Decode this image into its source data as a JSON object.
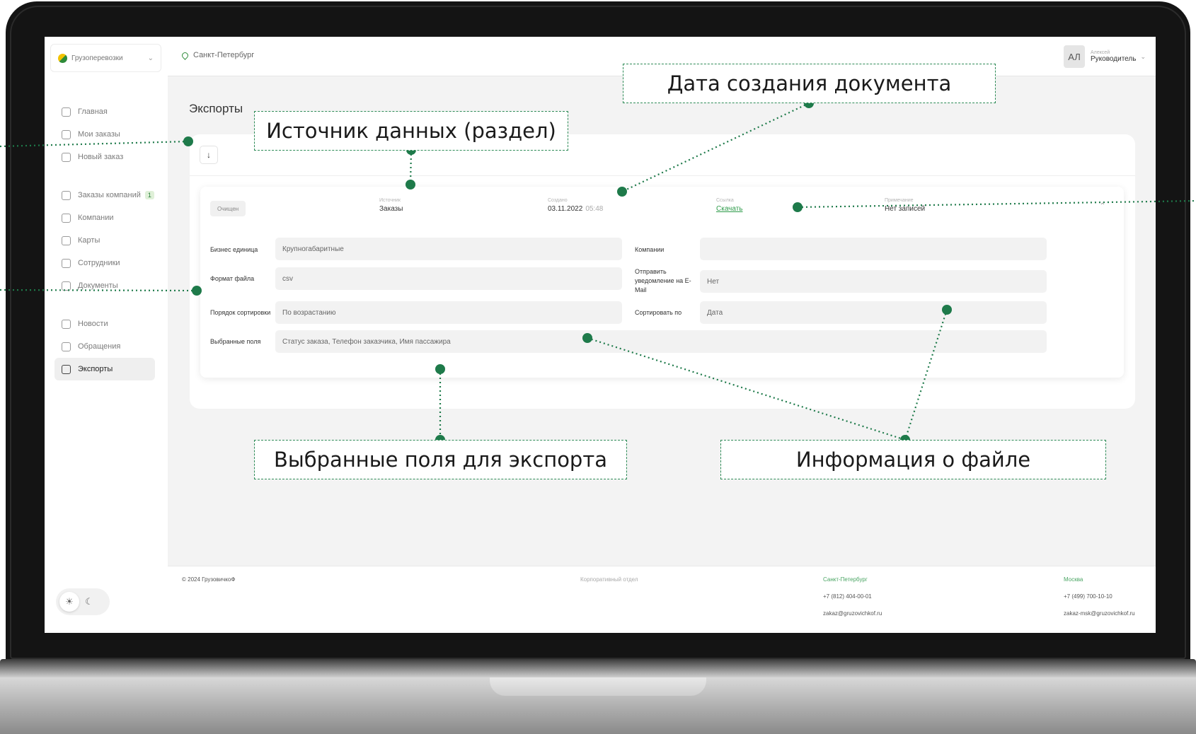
{
  "sidebar": {
    "company": "Грузоперевозки",
    "nav": [
      {
        "label": "Главная",
        "icon": "home-icon"
      },
      {
        "label": "Мои заказы",
        "icon": "orders-icon"
      },
      {
        "label": "Новый заказ",
        "icon": "new-order-icon"
      },
      {
        "label": "Заказы компаний",
        "icon": "company-orders-icon",
        "badge": "1"
      },
      {
        "label": "Компании",
        "icon": "companies-icon"
      },
      {
        "label": "Карты",
        "icon": "cards-icon"
      },
      {
        "label": "Сотрудники",
        "icon": "employees-icon"
      },
      {
        "label": "Документы",
        "icon": "documents-icon"
      },
      {
        "label": "Новости",
        "icon": "news-icon"
      },
      {
        "label": "Обращения",
        "icon": "bell-icon"
      },
      {
        "label": "Экспорты",
        "icon": "export-icon",
        "active": true
      }
    ]
  },
  "topbar": {
    "city": "Санкт-Петербург",
    "avatar": "АЛ",
    "user_name": "Алексей",
    "user_role": "Руководитель"
  },
  "page": {
    "title": "Экспорты"
  },
  "export_card": {
    "status": "Очищен",
    "source_label": "Источник",
    "source_value": "Заказы",
    "created_label": "Создано",
    "created_date": "03.11.2022",
    "created_time": "05:48",
    "link_label": "Ссылка",
    "link_value": "Скачать",
    "extra_label": "Примечание",
    "extra_value": "Нет записей",
    "fields": {
      "business_unit_label": "Бизнес единица",
      "business_unit_value": "Крупногабаритные",
      "companies_label": "Компании",
      "companies_value": "",
      "file_format_label": "Формат файла",
      "file_format_value": "csv",
      "notify_label": "Отправить уведомление на E-Mail",
      "notify_value": "Нет",
      "sort_order_label": "Порядок сортировки",
      "sort_order_value": "По возрастанию",
      "sort_by_label": "Сортировать по",
      "sort_by_value": "Дата",
      "selected_fields_label": "Выбранные поля",
      "selected_fields_value": "Статус заказа, Телефон заказчика, Имя пассажира"
    }
  },
  "footer": {
    "copyright": "© 2024 ГрузовичкоФ",
    "dept": "Корпоративный отдел",
    "spb_city": "Санкт-Петербург",
    "spb_phone": "+7 (812) 404-00-01",
    "spb_email": "zakaz@gruzovichkof.ru",
    "msk_city": "Москва",
    "msk_phone": "+7 (499) 700-10-10",
    "msk_email": "zakaz-msk@gruzovichkof.ru"
  },
  "annotations": {
    "data_source": "Источник данных (раздел)",
    "created_date": "Дата создания документа",
    "selected_fields": "Выбранные поля для экспорта",
    "file_info": "Информация о файле"
  },
  "colors": {
    "accent": "#2e8b57",
    "link": "#2e9b4a"
  }
}
